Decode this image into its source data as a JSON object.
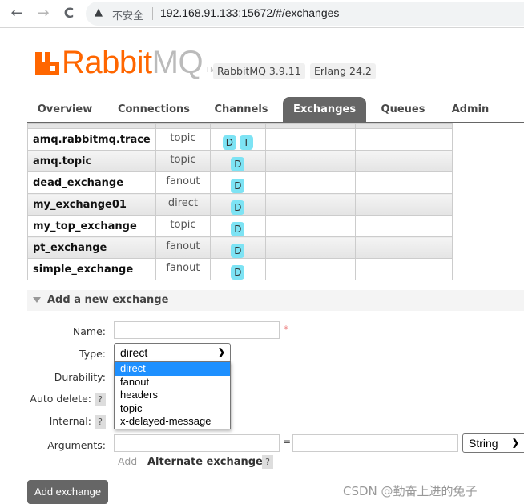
{
  "browser": {
    "back_icon": "←",
    "forward_icon": "→",
    "reload_icon": "C",
    "warning_icon": "▲",
    "security_label": "不安全",
    "url": "192.168.91.133:15672/#/exchanges"
  },
  "header": {
    "logo_primary": "Rabbit",
    "logo_secondary": "MQ",
    "logo_tm": "TM",
    "version": "RabbitMQ 3.9.11",
    "erlang": "Erlang 24.2"
  },
  "tabs": [
    {
      "label": "Overview",
      "active": false
    },
    {
      "label": "Connections",
      "active": false
    },
    {
      "label": "Channels",
      "active": false
    },
    {
      "label": "Exchanges",
      "active": true
    },
    {
      "label": "Queues",
      "active": false
    },
    {
      "label": "Admin",
      "active": false
    }
  ],
  "exchanges": [
    {
      "name": "amq.rabbitmq.trace",
      "type": "topic",
      "features": [
        "D",
        "I"
      ]
    },
    {
      "name": "amq.topic",
      "type": "topic",
      "features": [
        "D"
      ]
    },
    {
      "name": "dead_exchange",
      "type": "fanout",
      "features": [
        "D"
      ]
    },
    {
      "name": "my_exchange01",
      "type": "direct",
      "features": [
        "D"
      ]
    },
    {
      "name": "my_top_exchange",
      "type": "topic",
      "features": [
        "D"
      ]
    },
    {
      "name": "pt_exchange",
      "type": "fanout",
      "features": [
        "D"
      ]
    },
    {
      "name": "simple_exchange",
      "type": "fanout",
      "features": [
        "D"
      ]
    }
  ],
  "add_form": {
    "section_title": "Add a new exchange",
    "name_label": "Name:",
    "name_value": "",
    "required_mark": "*",
    "type_label": "Type:",
    "type_selected": "direct",
    "type_options": [
      "direct",
      "fanout",
      "headers",
      "topic",
      "x-delayed-message"
    ],
    "durability_label": "Durability:",
    "auto_delete_label": "Auto delete:",
    "internal_label": "Internal:",
    "help_mark": "?",
    "arguments_label": "Arguments:",
    "arg_key_value": "",
    "equals": "=",
    "arg_value_value": "",
    "arg_type_selected": "String",
    "add_link": "Add",
    "alternate_exchange": "Alternate exchange",
    "submit_label": "Add exchange"
  },
  "watermark": "CSDN @勤奋上进的兔子"
}
